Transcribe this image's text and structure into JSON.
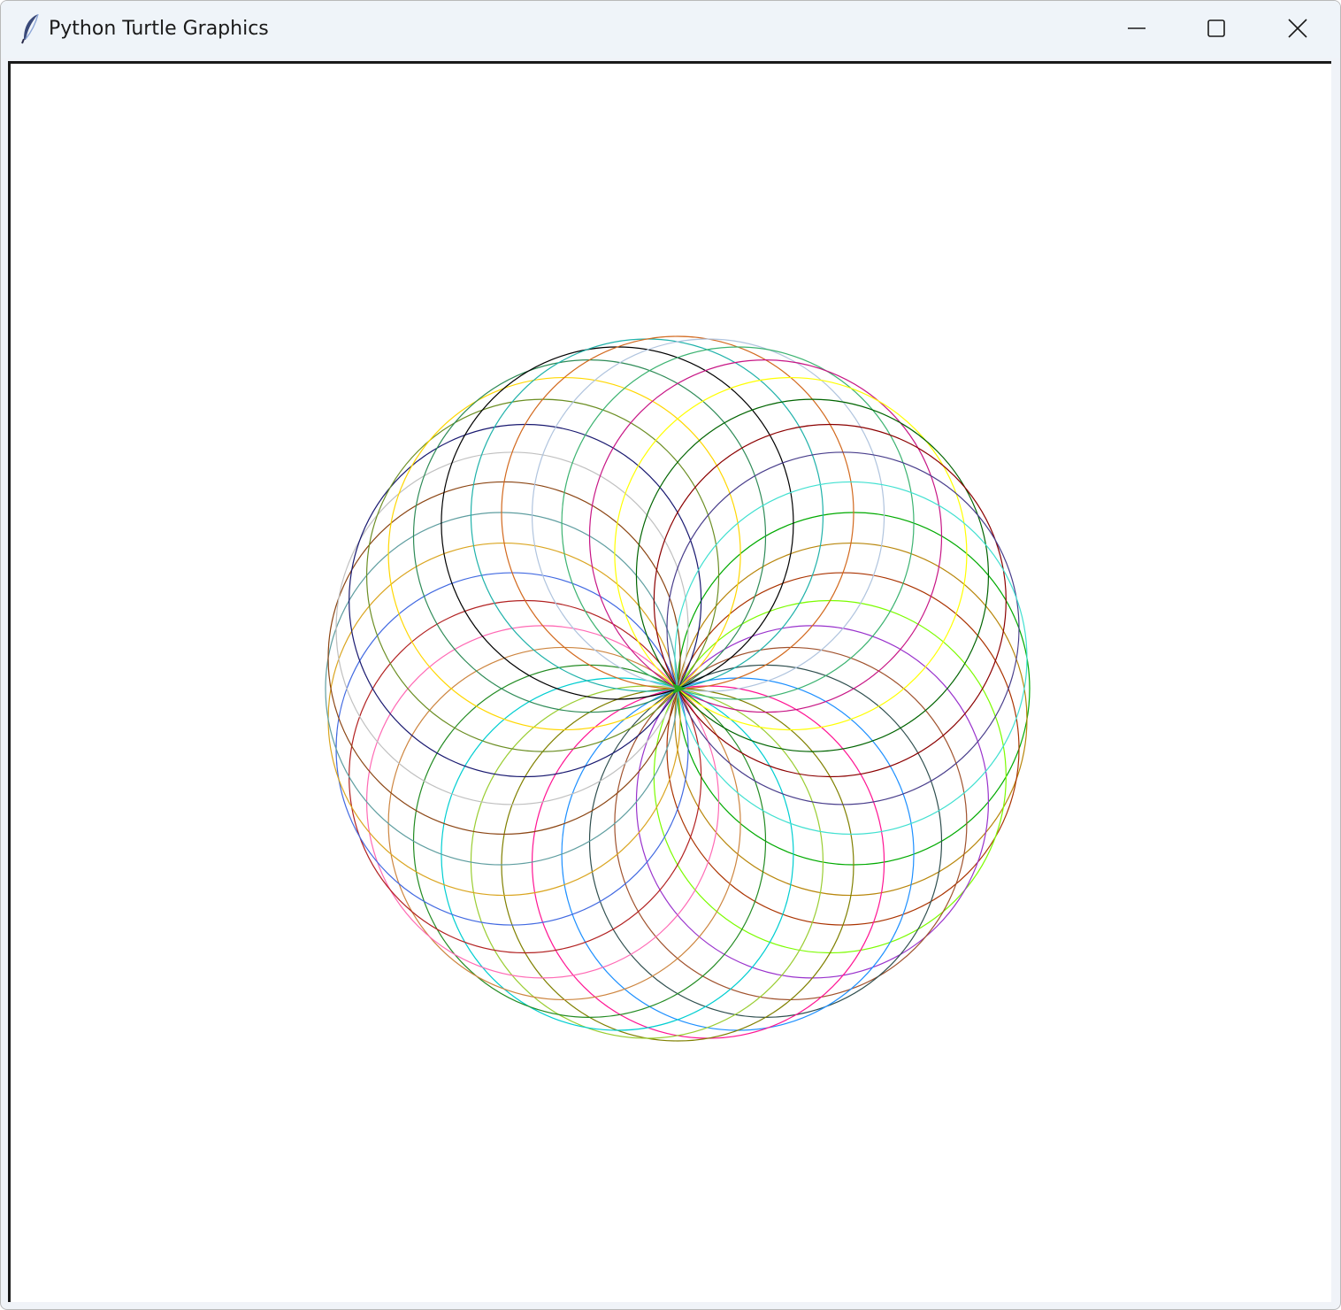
{
  "window": {
    "title": "Python Turtle Graphics",
    "app_icon": "feather-icon",
    "controls": {
      "minimize_icon": "minimize-icon",
      "maximize_icon": "maximize-icon",
      "close_icon": "close-icon"
    }
  },
  "canvas": {
    "background": "#ffffff",
    "drawing": "spirograph-circles",
    "circle_count": 36,
    "rotation_step_degrees": 10,
    "pen_colors": [
      "#00aa00",
      "#b8860b",
      "#aa3300",
      "#7cfc00",
      "#9932cc",
      "#a0522d",
      "#2f4f4f",
      "#1e90ff",
      "#ff1493",
      "#808000",
      "#9acd32",
      "#00ced1",
      "#228b22",
      "#cd853f",
      "#ff69b4",
      "#b22222",
      "#4169e1",
      "#daa520",
      "#5f9ea0",
      "#8b4513",
      "#c0c0c0",
      "#191970",
      "#6b8e23",
      "#ffd700",
      "#2e8b57",
      "#000000",
      "#20b2aa",
      "#d2691e",
      "#b0c4de",
      "#3cb371",
      "#c71585",
      "#ffff00",
      "#006400",
      "#8b0000",
      "#483d8b",
      "#40e0d0"
    ]
  }
}
